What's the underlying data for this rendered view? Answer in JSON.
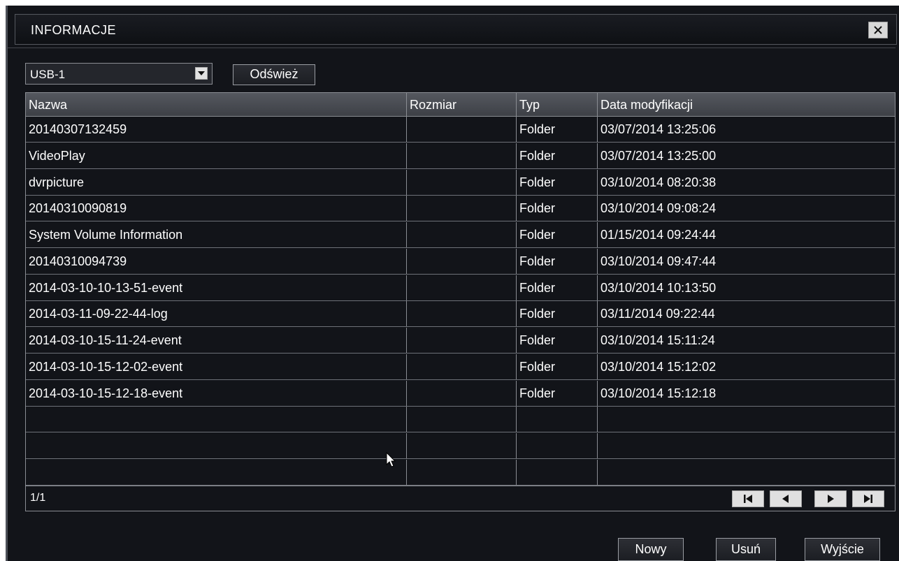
{
  "window": {
    "title": "INFORMACJE"
  },
  "device": {
    "selected": "USB-1",
    "refresh_label": "Odśwież"
  },
  "table": {
    "columns": [
      "Nazwa",
      "Rozmiar",
      "Typ",
      "Data modyfikacji"
    ],
    "rows": [
      [
        "20140307132459",
        "",
        "Folder",
        "03/07/2014 13:25:06"
      ],
      [
        "VideoPlay",
        "",
        "Folder",
        "03/07/2014 13:25:00"
      ],
      [
        "dvrpicture",
        "",
        "Folder",
        "03/10/2014 08:20:38"
      ],
      [
        "20140310090819",
        "",
        "Folder",
        "03/10/2014 09:08:24"
      ],
      [
        "System Volume Information",
        "",
        "Folder",
        "01/15/2014 09:24:44"
      ],
      [
        "20140310094739",
        "",
        "Folder",
        "03/10/2014 09:47:44"
      ],
      [
        "2014-03-10-10-13-51-event",
        "",
        "Folder",
        "03/10/2014 10:13:50"
      ],
      [
        "2014-03-11-09-22-44-log",
        "",
        "Folder",
        "03/11/2014 09:22:44"
      ],
      [
        "2014-03-10-15-11-24-event",
        "",
        "Folder",
        "03/10/2014 15:11:24"
      ],
      [
        "2014-03-10-15-12-02-event",
        "",
        "Folder",
        "03/10/2014 15:12:02"
      ],
      [
        "2014-03-10-15-12-18-event",
        "",
        "Folder",
        "03/10/2014 15:12:18"
      ],
      [
        "",
        "",
        "",
        ""
      ],
      [
        "",
        "",
        "",
        ""
      ],
      [
        "",
        "",
        "",
        ""
      ]
    ],
    "page_indicator": "1/1"
  },
  "pager": {
    "icons": [
      "first-page-icon",
      "previous-page-icon",
      "next-page-icon",
      "last-page-icon"
    ]
  },
  "actions": {
    "new_label": "Nowy",
    "delete_label": "Usuń",
    "exit_label": "Wyjście"
  },
  "colors": {
    "background": "#121419",
    "header": "#4a4d53",
    "grid": "#6e7178",
    "button_face": "#e0e0e0"
  }
}
